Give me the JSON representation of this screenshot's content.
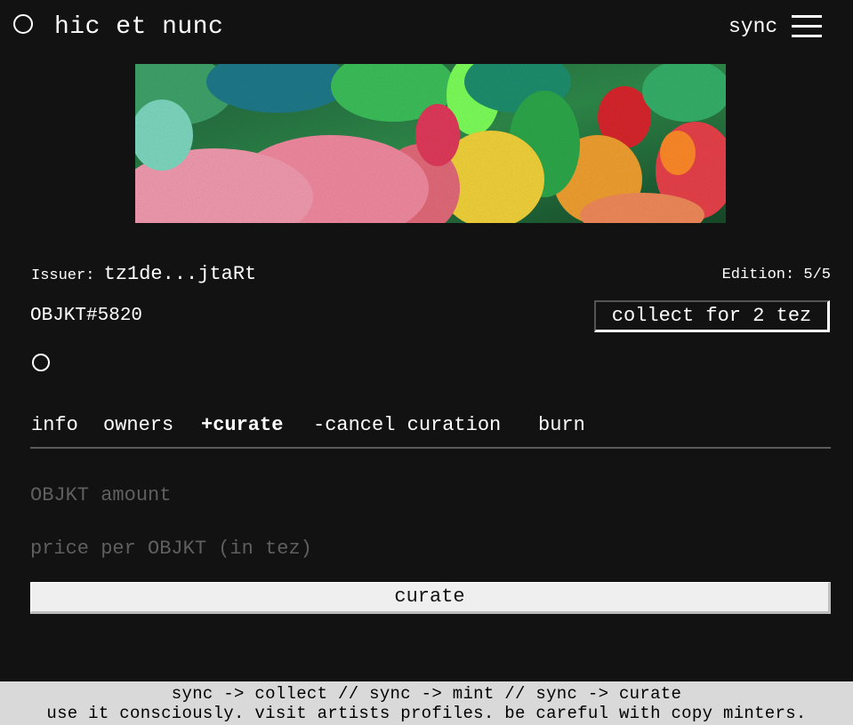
{
  "header": {
    "logo_text": "hic et nunc",
    "sync_label": "sync"
  },
  "token": {
    "issuer_label": "Issuer:",
    "issuer_address": "tz1de...jtaRt",
    "edition_label": "Edition:",
    "edition_value": "5/5",
    "id": "OBJKT#5820",
    "collect_label": "collect for 2 tez"
  },
  "tabs": [
    {
      "label": "info"
    },
    {
      "label": "owners"
    },
    {
      "label": "+curate"
    },
    {
      "label": "-cancel curation"
    },
    {
      "label": "burn"
    }
  ],
  "form": {
    "amount_placeholder": "OBJKT amount",
    "amount_value": "",
    "price_placeholder": "price per OBJKT (in tez)",
    "price_value": "",
    "submit_label": "curate"
  },
  "footer": {
    "line1": "sync -> collect // sync -> mint // sync -> curate",
    "line2": "use it consciously. visit artists profiles. be careful with copy minters."
  },
  "colors": {
    "background": "#121212",
    "text": "#ffffff",
    "placeholder": "#5f5f5f",
    "footer_bg": "#d9d9d9",
    "button_bg": "#efefef"
  },
  "icons": [
    "logo-circle-icon",
    "hamburger-menu-icon",
    "creator-circle-icon"
  ]
}
